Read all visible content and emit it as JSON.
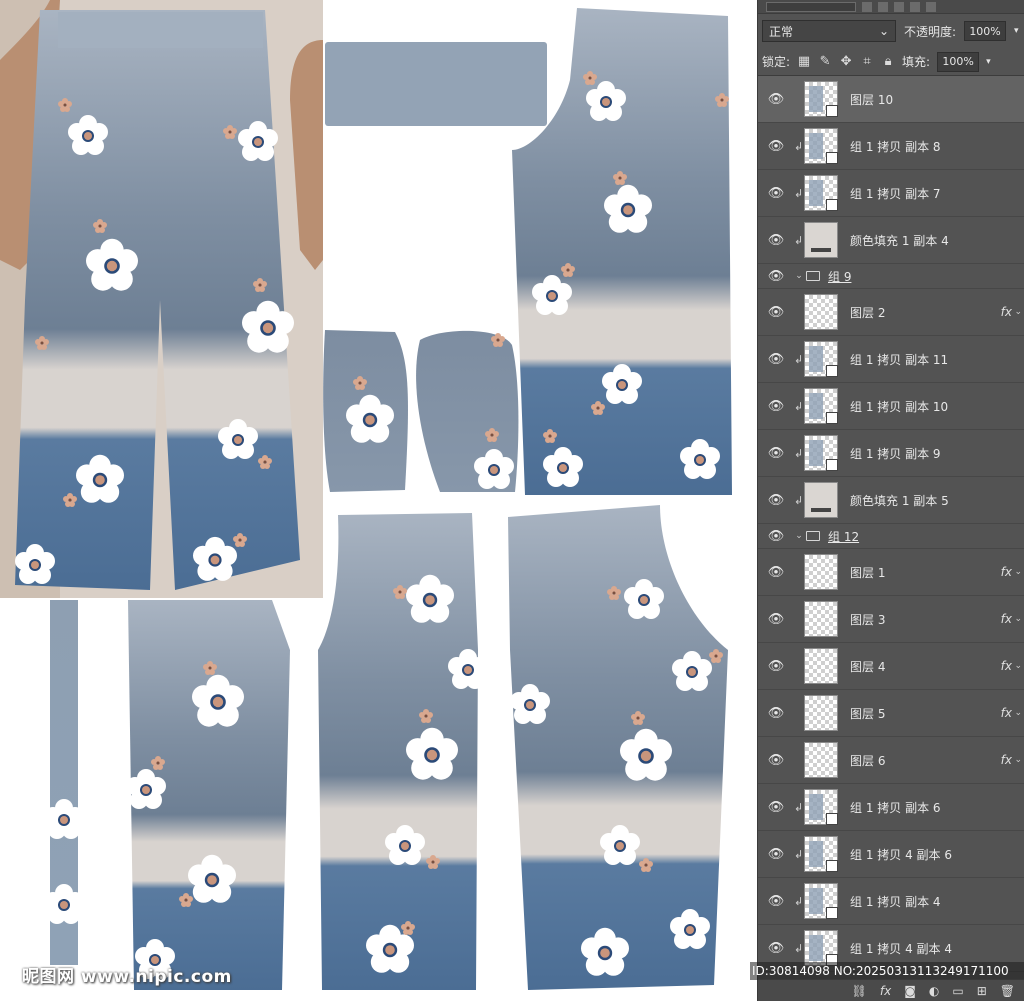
{
  "watermark": "昵图网 www.nipic.com",
  "image_id": "ID:30814098 NO:20250313113249171100",
  "colors": {
    "denim_top": "#a9b4c2",
    "denim_mid": "#6f8196",
    "denim_bottom": "#4f6f93",
    "stripe": "#d8d3cf",
    "petal": "#ffffff",
    "flower_center": "#c9957c",
    "flower_ring": "#2b4a78",
    "panel_bg": "#535353"
  },
  "panel": {
    "blend_mode": "正常",
    "opacity_label": "不透明度:",
    "opacity_value": "100%",
    "lock_label": "锁定:",
    "fill_label": "填充:",
    "fill_value": "100%"
  },
  "layers": [
    {
      "name": "图层 10",
      "type": "layer",
      "thumb": "art",
      "clip": false,
      "fx": false,
      "selected": true
    },
    {
      "name": "组 1 拷贝 副本 8",
      "type": "layer",
      "thumb": "art",
      "clip": true,
      "fx": false
    },
    {
      "name": "组 1 拷贝 副本 7",
      "type": "layer",
      "thumb": "art",
      "clip": true,
      "fx": false
    },
    {
      "name": "颜色填充 1 副本 4",
      "type": "layer",
      "thumb": "fill",
      "clip": true,
      "fx": false
    },
    {
      "name": "组 9",
      "type": "group"
    },
    {
      "name": "图层 2",
      "type": "layer",
      "thumb": "empty",
      "clip": false,
      "fx": true
    },
    {
      "name": "组 1 拷贝 副本 11",
      "type": "layer",
      "thumb": "art",
      "clip": true,
      "fx": false
    },
    {
      "name": "组 1 拷贝 副本 10",
      "type": "layer",
      "thumb": "art",
      "clip": true,
      "fx": false
    },
    {
      "name": "组 1 拷贝 副本 9",
      "type": "layer",
      "thumb": "art",
      "clip": true,
      "fx": false
    },
    {
      "name": "颜色填充 1 副本 5",
      "type": "layer",
      "thumb": "fill",
      "clip": true,
      "fx": false
    },
    {
      "name": "组 12",
      "type": "group"
    },
    {
      "name": "图层 1",
      "type": "layer",
      "thumb": "empty",
      "clip": false,
      "fx": true
    },
    {
      "name": "图层 3",
      "type": "layer",
      "thumb": "empty",
      "clip": false,
      "fx": true
    },
    {
      "name": "图层 4",
      "type": "layer",
      "thumb": "empty",
      "clip": false,
      "fx": true
    },
    {
      "name": "图层 5",
      "type": "layer",
      "thumb": "empty",
      "clip": false,
      "fx": true
    },
    {
      "name": "图层 6",
      "type": "layer",
      "thumb": "empty",
      "clip": false,
      "fx": true
    },
    {
      "name": "组 1 拷贝 副本 6",
      "type": "layer",
      "thumb": "art",
      "clip": true,
      "fx": false
    },
    {
      "name": "组 1 拷贝 4 副本 6",
      "type": "layer",
      "thumb": "art",
      "clip": true,
      "fx": false
    },
    {
      "name": "组 1 拷贝 副本 4",
      "type": "layer",
      "thumb": "art",
      "clip": true,
      "fx": false
    },
    {
      "name": "组 1 拷贝 4 副本 4",
      "type": "layer",
      "thumb": "art",
      "clip": true,
      "fx": false
    }
  ],
  "icons": {
    "eye": "eye-icon",
    "fx": "fx",
    "folder": "folder-icon"
  }
}
